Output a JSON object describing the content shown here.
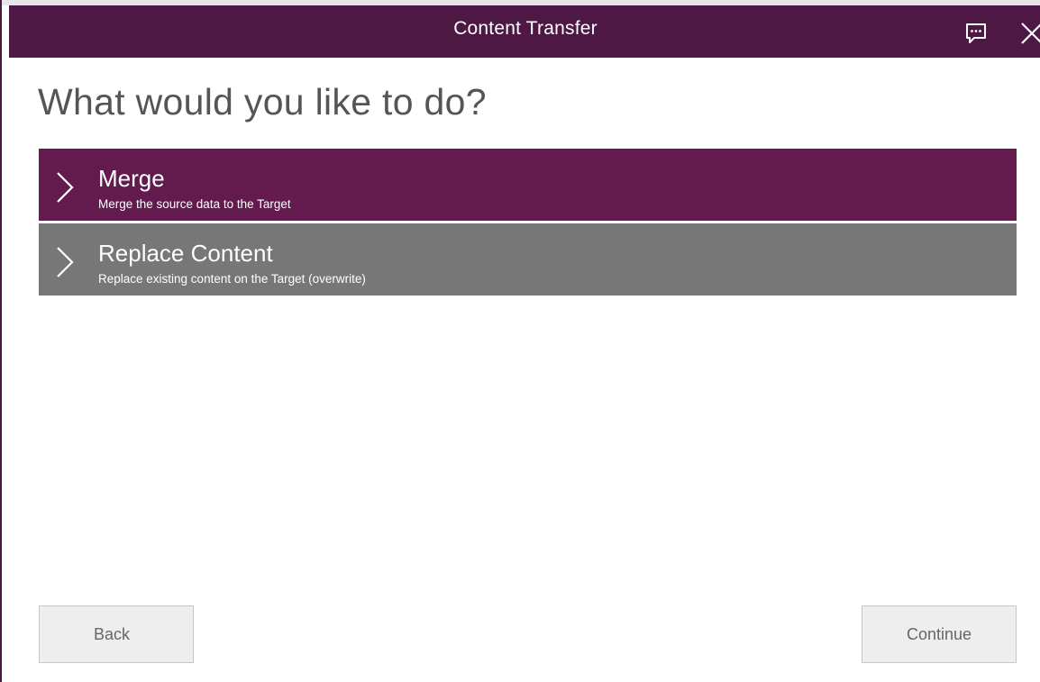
{
  "window": {
    "title": "Content Transfer"
  },
  "icons": {
    "feedback": "feedback-icon",
    "close": "close-icon",
    "chevron": "chevron-right-icon"
  },
  "main": {
    "heading": "What would you like to do?",
    "options": [
      {
        "title": "Merge",
        "description": "Merge the source data to the Target",
        "selected": true
      },
      {
        "title": "Replace Content",
        "description": "Replace existing content on the Target (overwrite)",
        "selected": false
      }
    ]
  },
  "footer": {
    "back_label": "Back",
    "continue_label": "Continue"
  },
  "colors": {
    "titlebar": "#4d1944",
    "selected_option": "#621a4f",
    "unselected_option": "#777777",
    "button_bg": "#eeeeee"
  }
}
